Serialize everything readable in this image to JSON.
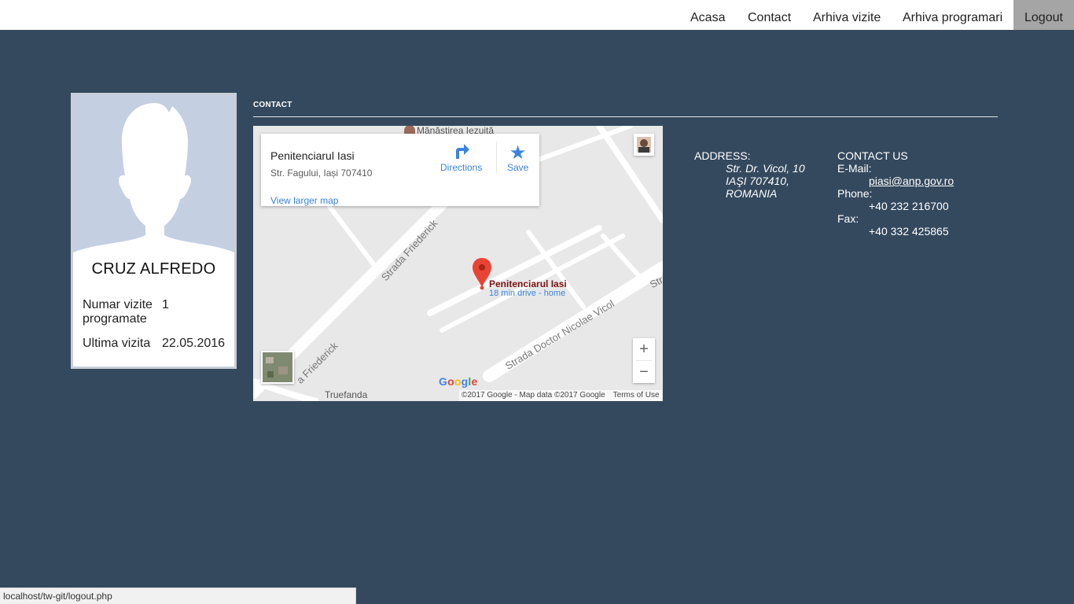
{
  "nav": {
    "items": [
      "Acasa",
      "Contact",
      "Arhiva vizite",
      "Arhiva programari"
    ],
    "logout": "Logout"
  },
  "profile": {
    "name": "CRUZ ALFREDO",
    "stats": [
      {
        "label": "Numar vizite programate",
        "value": "1"
      },
      {
        "label": "Ultima vizita",
        "value": "22.05.2016"
      }
    ]
  },
  "contact": {
    "heading": "CONTACT",
    "map": {
      "place_title": "Penitenciarul Iasi",
      "place_address": "Str. Fagului, Iași 707410",
      "larger_map": "View larger map",
      "directions": "Directions",
      "save": "Save",
      "pin_title": "Penitenciarul Iasi",
      "pin_subtitle": "18 min drive - home",
      "road_labels": [
        "Strada Friederick",
        "a Friederick",
        "Strada Doctor Nicolae Vicol",
        "Str"
      ],
      "place_labels": [
        "Mănăstirea Iezuită",
        "Truefanda"
      ],
      "google": "Google",
      "attribution": "©2017 Google - Map data ©2017 Google",
      "terms": "Terms of Use",
      "zoom_in": "+",
      "zoom_out": "−"
    },
    "address": {
      "label": "ADDRESS:",
      "lines": [
        "Str. Dr. Vicol, 10",
        "IAŞI 707410,",
        "ROMANIA"
      ]
    },
    "contact_us": {
      "label": "CONTACT US",
      "email_label": "E-Mail:",
      "email": "piasi@anp.gov.ro",
      "phone_label": "Phone:",
      "phone": "+40 232 216700",
      "fax_label": "Fax:",
      "fax": "+40 332 425865"
    }
  },
  "status_bar": "localhost/tw-git/logout.php",
  "colors": {
    "background": "#34495e",
    "link_blue": "#3a84df",
    "pin_red": "#ea4335"
  }
}
